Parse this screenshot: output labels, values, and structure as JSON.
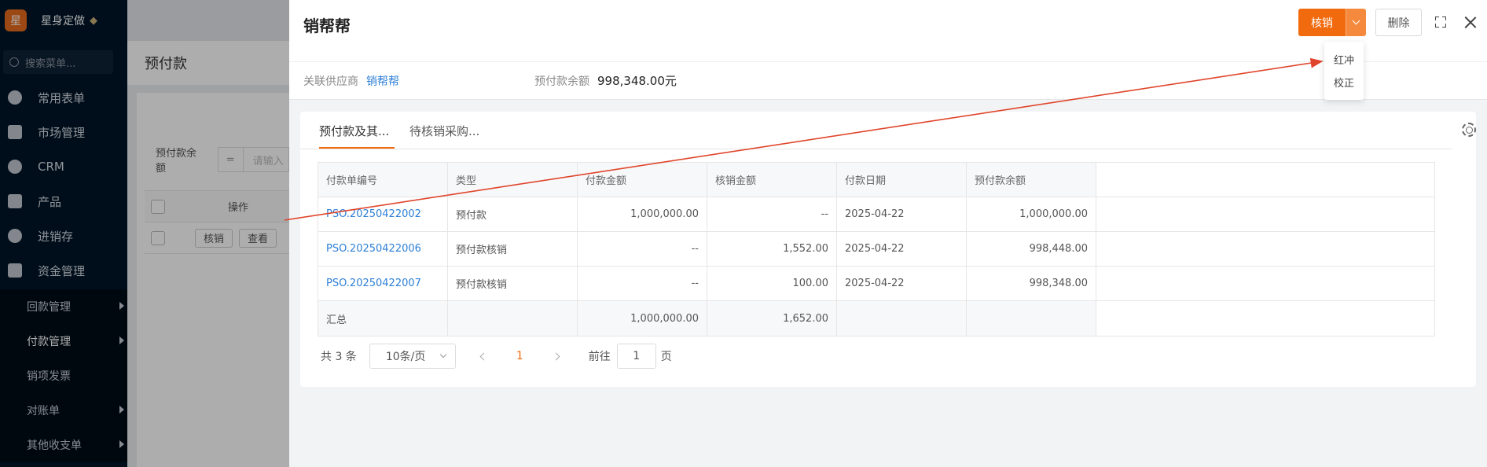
{
  "sidebar": {
    "logo_char": "星",
    "brand": "星身定做",
    "search_placeholder": "搜索菜单...",
    "items": [
      {
        "label": "常用表单"
      },
      {
        "label": "市场管理"
      },
      {
        "label": "CRM"
      },
      {
        "label": "产品"
      },
      {
        "label": "进销存"
      },
      {
        "label": "资金管理"
      }
    ],
    "subitems": [
      {
        "label": "回款管理"
      },
      {
        "label": "付款管理"
      },
      {
        "label": "销项发票"
      },
      {
        "label": "对账单"
      },
      {
        "label": "其他收支单"
      }
    ]
  },
  "background": {
    "page_title": "预付款",
    "filter_label": "预付款余额",
    "filter_op": "=",
    "filter_placeholder": "请输入",
    "col_operation": "操作",
    "btn_verify": "核销",
    "btn_view": "查看"
  },
  "drawer": {
    "title": "销帮帮",
    "btn_primary": "核销",
    "btn_delete": "删除",
    "info": {
      "supplier_label": "关联供应商",
      "supplier_value": "销帮帮",
      "balance_label": "预付款余额",
      "balance_value": "998,348.00元"
    },
    "tabs": [
      {
        "label": "预付款及其..."
      },
      {
        "label": "待核销采购..."
      }
    ],
    "table": {
      "headers": [
        "付款单编号",
        "类型",
        "付款金额",
        "核销金额",
        "付款日期",
        "预付款余额"
      ],
      "rows": [
        [
          "PSO.20250422002",
          "预付款",
          "1,000,000.00",
          "--",
          "2025-04-22",
          "1,000,000.00"
        ],
        [
          "PSO.20250422006",
          "预付款核销",
          "--",
          "1,552.00",
          "2025-04-22",
          "998,448.00"
        ],
        [
          "PSO.20250422007",
          "预付款核销",
          "--",
          "100.00",
          "2025-04-22",
          "998,348.00"
        ]
      ],
      "summary": [
        "汇总",
        "",
        "1,000,000.00",
        "1,652.00",
        "",
        ""
      ]
    },
    "pager": {
      "total": "共 3 条",
      "page_size": "10条/页",
      "current_page": "1",
      "goto_label": "前往",
      "goto_value": "1",
      "page_unit": "页"
    },
    "dropdown": [
      {
        "label": "红冲"
      },
      {
        "label": "校正"
      }
    ]
  },
  "colors": {
    "accent": "#f26a0e",
    "link": "#2d7fd6",
    "sidebar_bg": "#001529",
    "annotation_arrow": "#e0452b"
  }
}
